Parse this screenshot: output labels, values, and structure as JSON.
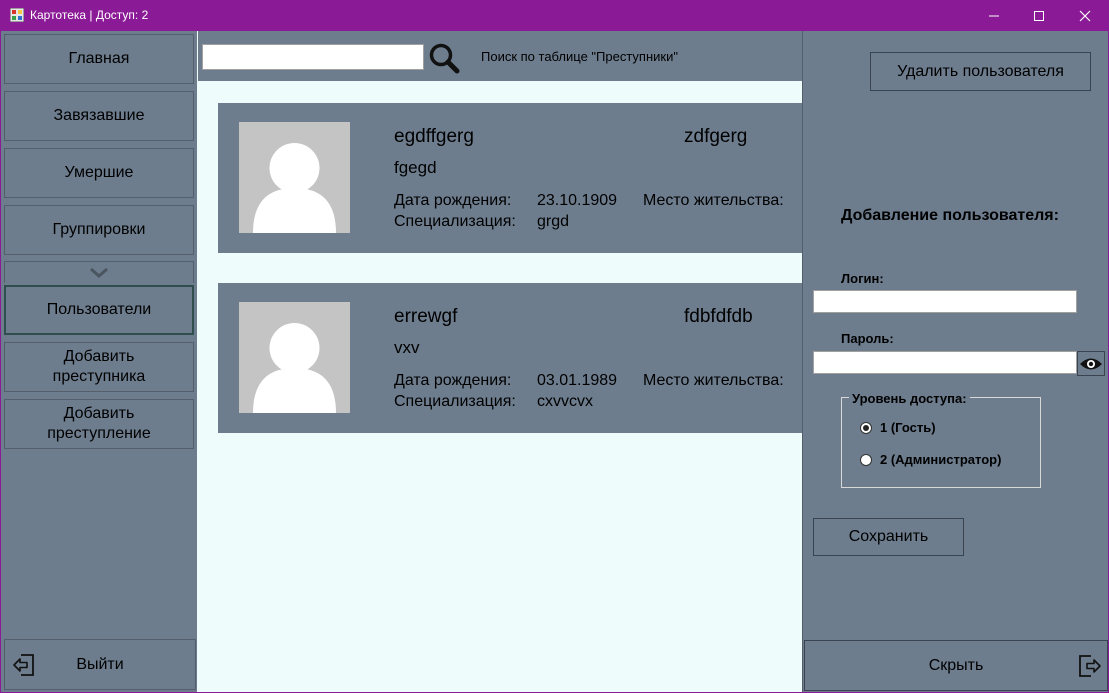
{
  "window": {
    "title": "Картотека | Доступ: 2",
    "controls": [
      "minimize-icon",
      "maximize-icon",
      "close-icon"
    ]
  },
  "sidebar": {
    "items": [
      {
        "label": "Главная"
      },
      {
        "label": "Завязавшие"
      },
      {
        "label": "Умершие"
      },
      {
        "label": "Группировки"
      },
      {
        "label": "Пользователи",
        "active": true
      },
      {
        "label": "Добавить\nпреступника"
      },
      {
        "label": "Добавить\nпреступление"
      }
    ],
    "collapse_icon": "chevron-down-icon",
    "logout_label": "Выйти"
  },
  "search": {
    "value": "",
    "label": "Поиск по таблице \"Преступники\""
  },
  "cards": [
    {
      "name_left": "egdffgerg",
      "name_right": "zdfgerg",
      "subtitle": "fgegd",
      "birth_label": "Дата рождения:",
      "birth_value": "23.10.1909",
      "residence_label": "Место жительства:",
      "spec_label": "Специализация:",
      "spec_value": "grgd"
    },
    {
      "name_left": "errewgf",
      "name_right": "fdbfdfdb",
      "subtitle": "vxv",
      "birth_label": "Дата рождения:",
      "birth_value": "03.01.1989",
      "residence_label": "Место жительства:",
      "spec_label": "Специализация:",
      "spec_value": "cxvvcvx"
    }
  ],
  "right_panel": {
    "delete_user_label": "Удалить пользователя",
    "heading": "Добавление пользователя:",
    "login_label": "Логин:",
    "login_value": "",
    "password_label": "Пароль:",
    "password_value": "",
    "access_level_label": "Уровень доступа:",
    "access_options": [
      {
        "label": "1 (Гость)",
        "selected": true
      },
      {
        "label": "2 (Администратор)",
        "selected": false
      }
    ],
    "save_label": "Сохранить",
    "hide_label": "Скрыть"
  },
  "colors": {
    "titlebar": "#8b1a96",
    "panel": "#6d7d8e",
    "content_bg": "#eefcfc",
    "photo_bg": "#c4c4c4"
  }
}
